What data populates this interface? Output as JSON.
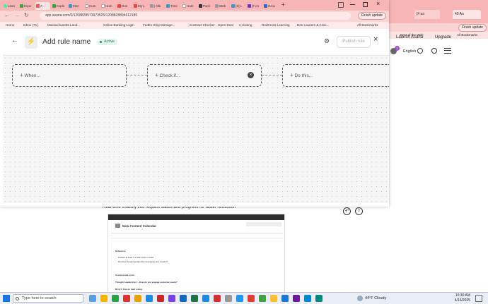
{
  "left_window": {
    "tabs": [
      "Lean",
      "Expe",
      "X",
      "Explo",
      "Meri",
      "Hum",
      "Hum",
      "Don",
      "My L",
      "| Obi",
      "Time",
      "Hum",
      "Pack",
      "Web",
      "[S] L",
      "[# un",
      "Grou"
    ],
    "url": "app.asana.com/0/1208828573973525/1208828894612185",
    "finish_update": "Finish update",
    "bookmarks": [
      "Home",
      "Inbox (71)",
      "Massachusetts Land...",
      "Online Banking Login",
      "FedEx Ship Manage...",
      "Contract Checker",
      "Open Door",
      "e-closing",
      "RedCross Learning",
      "Des Lauriers & Asso...",
      "All Bookmarks"
    ]
  },
  "rule": {
    "title": "Add rule name",
    "status": "Active",
    "publish": "Publish rule",
    "when": "When...",
    "check_if": "Check if...",
    "do_this": "Do this..."
  },
  "right_window": {
    "tabs": [
      "[# un",
      "40 An"
    ],
    "finish_update": "Finish update",
    "bookmarks": [
      "Best of the Web",
      "All Bookmarks"
    ],
    "nav": {
      "launch": "Launch Asana",
      "upgrade": "Upgrade",
      "english": "English",
      "badge": "1"
    }
  },
  "page_below": {
    "text": "Real-time visibility into request status and progress for faster resolution",
    "embedded": {
      "title": "New Content Calendar",
      "rows": [
        "Reference",
        "Publish at least 6 social posts in 2022",
        "Develop thought-leadership messaging and research",
        "Social media posts",
        "Thought Leadership 1 - How do you engage customer needs?",
        "Blog 2: How to start a blog"
      ]
    }
  },
  "taskbar": {
    "search": "Type here to search",
    "weather": "44°F  Cloudy",
    "time": "10:30 AM",
    "date": "4/16/2025"
  }
}
